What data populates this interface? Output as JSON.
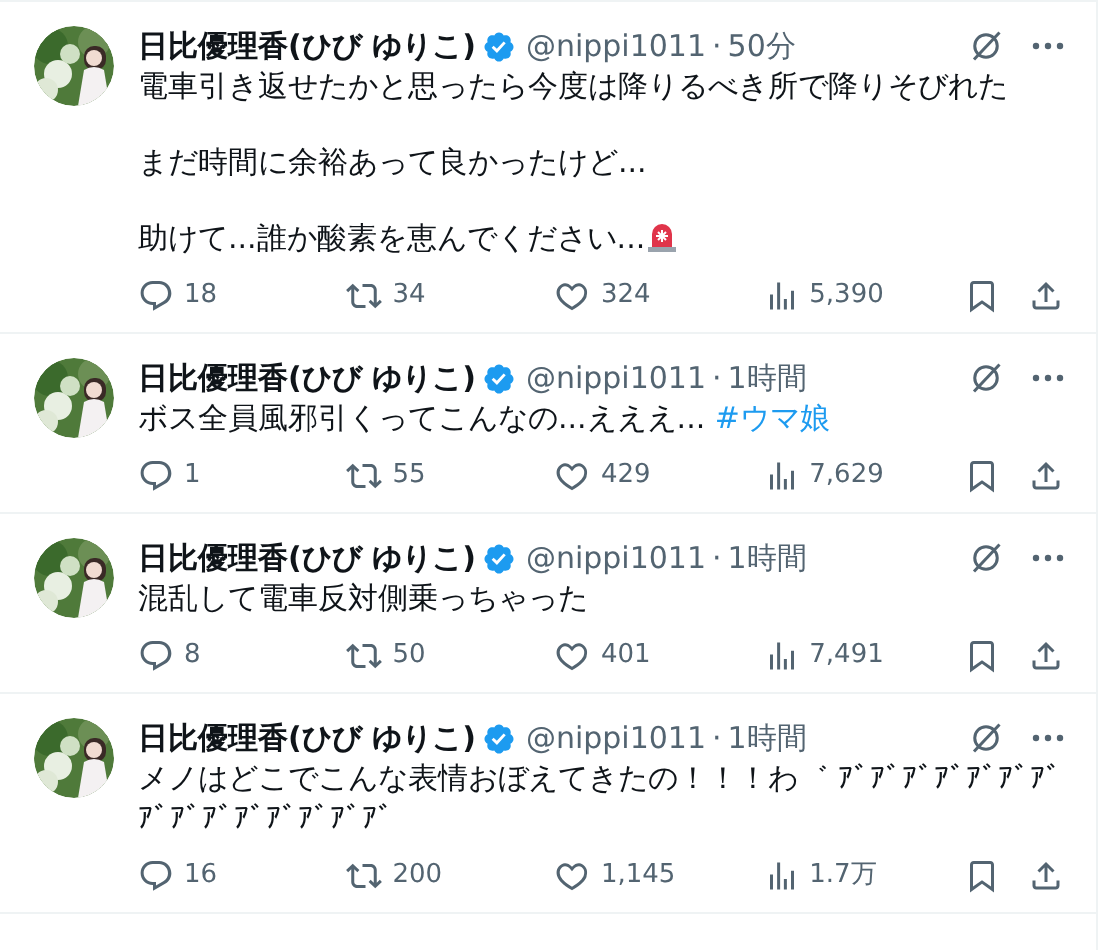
{
  "tweets": [
    {
      "name": "日比優理香(ひび ゆりこ)",
      "handle": "@nippi1011",
      "separator": "·",
      "time": "50分",
      "paragraphs": [
        [
          {
            "kind": "text",
            "text": "電車引き返せたかと思ったら今度は降りるべき所で降りそびれた"
          }
        ],
        [
          {
            "kind": "text",
            "text": "まだ時間に余裕あって良かったけど..."
          }
        ],
        [
          {
            "kind": "text",
            "text": "助けて...誰か酸素を恵んでください..."
          },
          {
            "kind": "emoji"
          }
        ]
      ],
      "replies": "18",
      "reposts": "34",
      "likes": "324",
      "views": "5,390"
    },
    {
      "name": "日比優理香(ひび ゆりこ)",
      "handle": "@nippi1011",
      "separator": "·",
      "time": "1時間",
      "paragraphs": [
        [
          {
            "kind": "text",
            "text": "ボス全員風邪引くってこんなの...えええ... "
          },
          {
            "kind": "hashtag",
            "text": "#ウマ娘"
          }
        ]
      ],
      "replies": "1",
      "reposts": "55",
      "likes": "429",
      "views": "7,629"
    },
    {
      "name": "日比優理香(ひび ゆりこ)",
      "handle": "@nippi1011",
      "separator": "·",
      "time": "1時間",
      "paragraphs": [
        [
          {
            "kind": "text",
            "text": "混乱して電車反対側乗っちゃった"
          }
        ]
      ],
      "replies": "8",
      "reposts": "50",
      "likes": "401",
      "views": "7,491"
    },
    {
      "name": "日比優理香(ひび ゆりこ)",
      "handle": "@nippi1011",
      "separator": "·",
      "time": "1時間",
      "paragraphs": [
        [
          {
            "kind": "text",
            "text": "メノはどこでこんな表情おぼえてきたの！！！わ゛ ｱﾞｱﾞｱﾞｱﾞｱﾞｱﾞｱﾞｱﾞｱﾞｱﾞｱﾞｱﾞｱﾞｱﾞｱﾞ"
          }
        ]
      ],
      "replies": "16",
      "reposts": "200",
      "likes": "1,145",
      "views": "1.7万"
    }
  ]
}
